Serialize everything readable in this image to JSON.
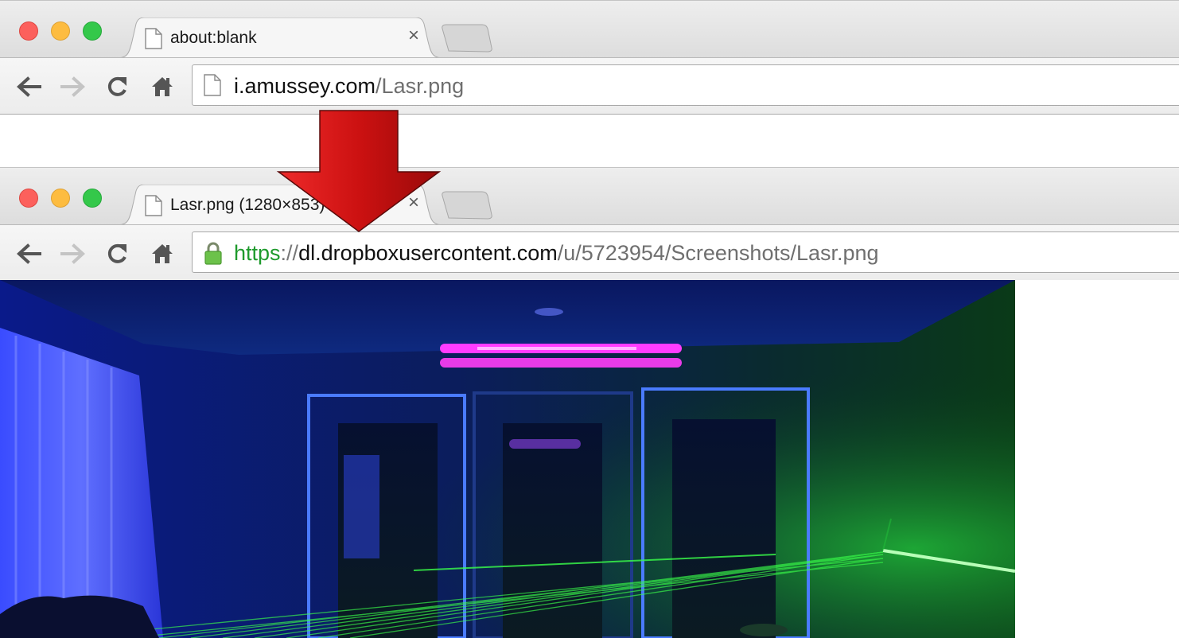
{
  "colors": {
    "close": "#fc605c",
    "minimize": "#fdbc40",
    "maximize": "#34c84a",
    "secure_scheme": "#1e9a2c",
    "arrow": "#cc1111"
  },
  "icons": {
    "back": "arrow-left-icon",
    "forward": "arrow-right-icon",
    "reload": "reload-icon",
    "home": "home-icon",
    "page": "page-icon",
    "lock": "lock-icon"
  },
  "window_before": {
    "tab_title": "about:blank",
    "tab_close": "×",
    "url_host": "i.amussey.com",
    "url_path": "/Lasr.png"
  },
  "window_after": {
    "tab_title": "Lasr.png (1280×853)",
    "tab_close": "×",
    "url_scheme": "https",
    "url_sep": "://",
    "url_host": "dl.dropboxusercontent.com",
    "url_path": "/u/5723954/Screenshots/Lasr.png"
  }
}
